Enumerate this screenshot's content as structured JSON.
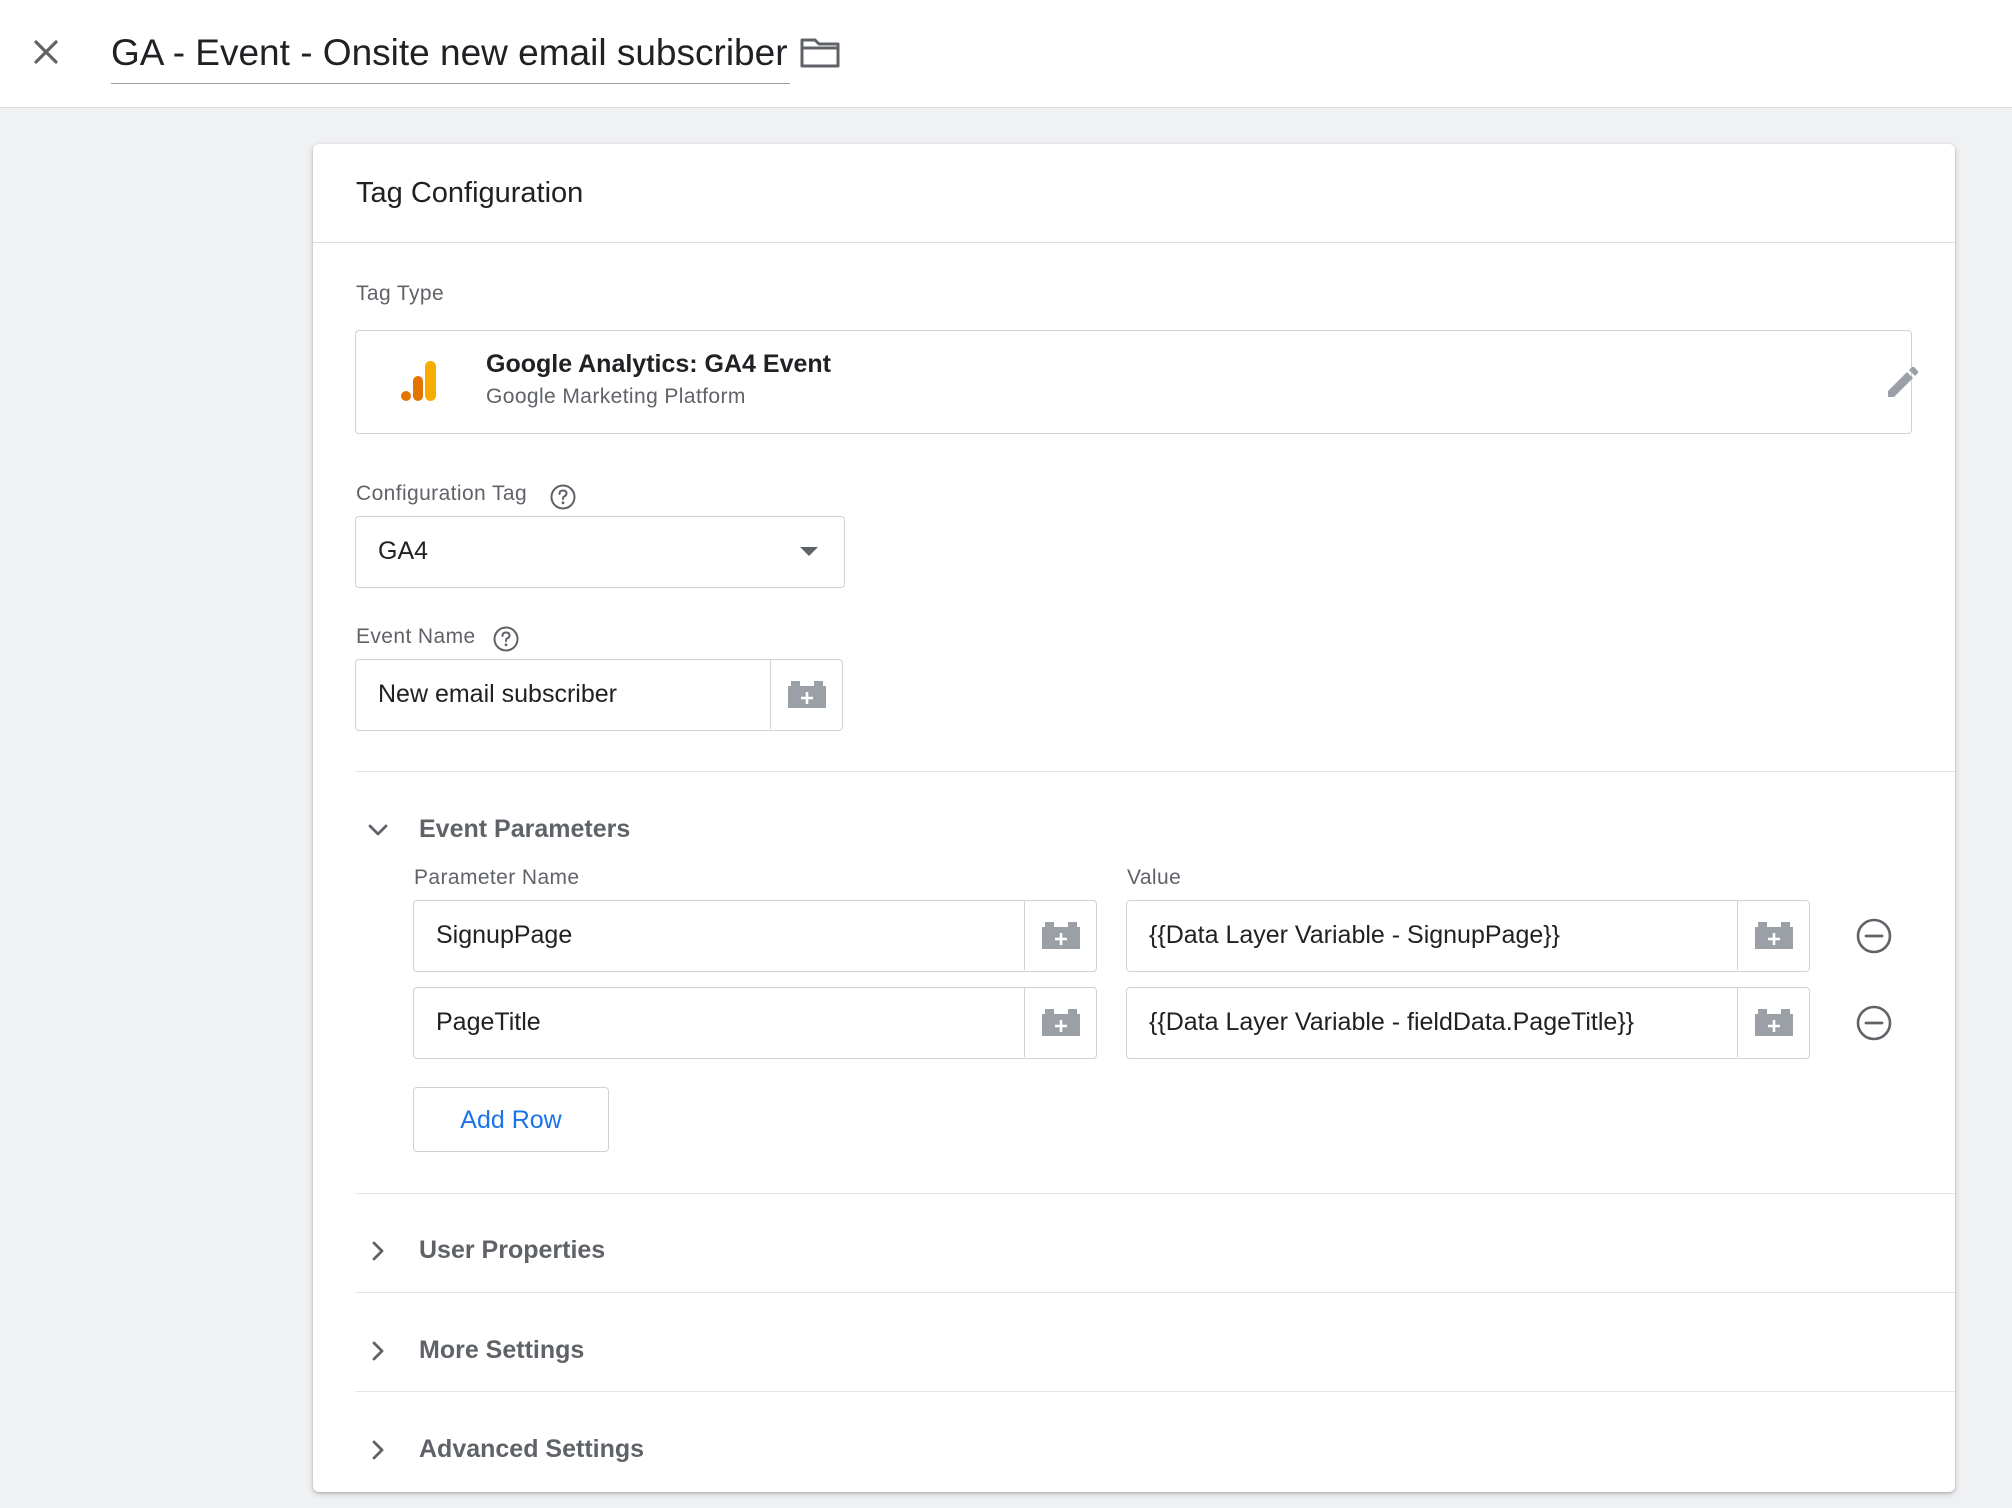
{
  "header": {
    "tag_name": "GA - Event - Onsite new email subscriber",
    "close_icon": "close-icon",
    "folder_icon": "folder-icon"
  },
  "card": {
    "title": "Tag Configuration",
    "tag_type": {
      "label": "Tag Type",
      "name": "Google Analytics: GA4 Event",
      "platform": "Google Marketing Platform",
      "icon": "google-analytics-icon",
      "icon_colors": [
        "#e37400",
        "#f9ab00"
      ]
    },
    "config_tag": {
      "label": "Configuration Tag",
      "value": "GA4"
    },
    "event_name": {
      "label": "Event Name",
      "value": "New email subscriber"
    },
    "event_parameters": {
      "label": "Event Parameters",
      "columns": {
        "name": "Parameter Name",
        "value": "Value"
      },
      "rows": [
        {
          "name": "SignupPage",
          "value": "{{Data Layer Variable - SignupPage}}"
        },
        {
          "name": "PageTitle",
          "value": "{{Data Layer Variable - fieldData.PageTitle}}"
        }
      ],
      "add_row_label": "Add Row"
    },
    "sections": {
      "user_properties": "User Properties",
      "more_settings": "More Settings",
      "advanced_settings": "Advanced Settings"
    }
  },
  "colors": {
    "accent": "#1a73e8",
    "background": "#f0f1f3"
  }
}
